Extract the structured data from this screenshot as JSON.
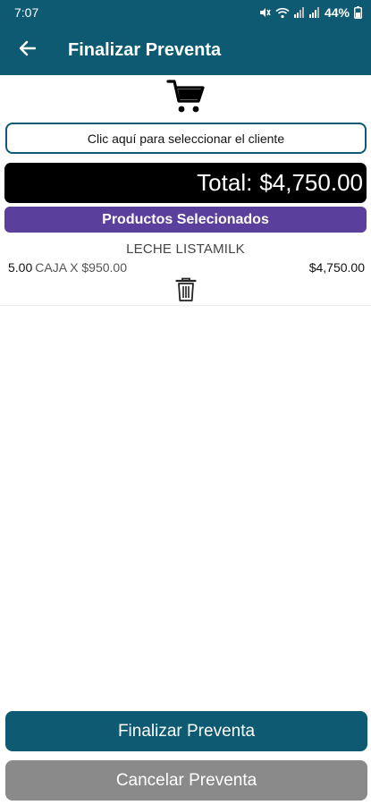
{
  "status_bar": {
    "time": "7:07",
    "battery": "44%",
    "icons": [
      "mute-icon",
      "wifi-icon",
      "signal-icon",
      "signal-icon",
      "battery-icon"
    ]
  },
  "app_bar": {
    "title": "Finalizar Preventa",
    "back_icon": "arrow-left-icon",
    "color": "#0d5a72"
  },
  "cart": {
    "icon": "shopping-cart-icon"
  },
  "client_selector": {
    "label": "Clic aquí para seleccionar el cliente"
  },
  "total": {
    "label": "Total:",
    "value": "$4,750.00"
  },
  "products_header": {
    "label": "Productos Selecionados",
    "color": "#5a3f9c"
  },
  "products": [
    {
      "name": "LECHE LISTAMILK",
      "quantity": "5.00",
      "unit": "CAJA X $950.00",
      "subtotal": "$4,750.00",
      "delete_icon": "trash-icon"
    }
  ],
  "actions": {
    "finalize_label": "Finalizar Preventa",
    "cancel_label": "Cancelar Preventa",
    "finalize_color": "#0d5a72",
    "cancel_color": "#8a8a8a"
  }
}
